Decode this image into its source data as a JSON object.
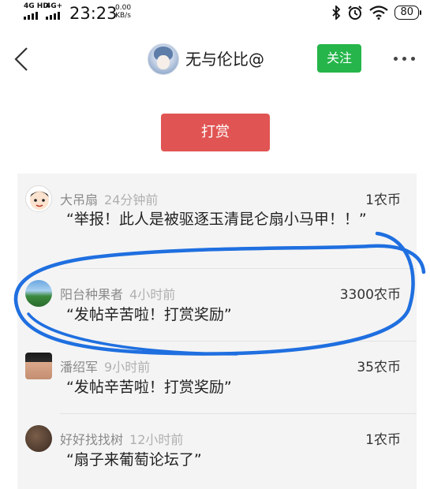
{
  "status_bar": {
    "network1": "4G HD",
    "network2": "4G+",
    "time": "23:23",
    "speed_value": "0.00",
    "speed_unit": "KB/s",
    "battery": "80"
  },
  "header": {
    "nickname": "无与伦比@",
    "follow_label": "关注"
  },
  "reward_button": "打赏",
  "rewards": [
    {
      "name": "大吊扇",
      "time": "24分钟前",
      "amount": "1农币",
      "message": "“举报！此人是被驱逐玉清昆仑扇小马甲！！”"
    },
    {
      "name": "阳台种果者",
      "time": "4小时前",
      "amount": "3300农币",
      "message": "“发帖辛苦啦！打赏奖励”"
    },
    {
      "name": "潘绍军",
      "time": "9小时前",
      "amount": "35农币",
      "message": "“发帖辛苦啦！打赏奖励”"
    },
    {
      "name": "好好找找树",
      "time": "12小时前",
      "amount": "1农币",
      "message": "“扇子来葡萄论坛了”"
    }
  ],
  "colors": {
    "follow_green": "#25b54a",
    "reward_red": "#e05553",
    "highlight_blue": "#1f6fe0"
  }
}
